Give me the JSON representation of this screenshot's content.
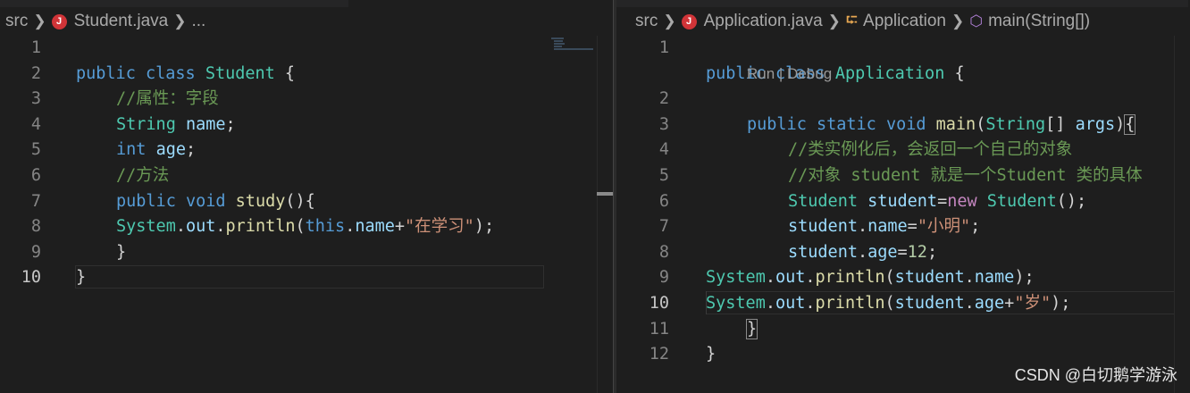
{
  "left": {
    "breadcrumb": {
      "folder": "src",
      "file": "Student.java",
      "more": "..."
    },
    "lines": [
      {
        "n": "1",
        "cur": false
      },
      {
        "n": "2",
        "cur": false
      },
      {
        "n": "3",
        "cur": false
      },
      {
        "n": "4",
        "cur": false
      },
      {
        "n": "5",
        "cur": false
      },
      {
        "n": "6",
        "cur": false
      },
      {
        "n": "7",
        "cur": false
      },
      {
        "n": "8",
        "cur": false
      },
      {
        "n": "9",
        "cur": false
      },
      {
        "n": "10",
        "cur": true
      }
    ],
    "code": {
      "l1": {
        "a": "public",
        "b": "class",
        "c": "Student",
        "d": " {"
      },
      "l2": {
        "a": "//属性：字段"
      },
      "l3": {
        "a": "String",
        "b": "name",
        "c": ";"
      },
      "l4": {
        "a": "int",
        "b": "age",
        "c": ";"
      },
      "l5": {
        "a": "//方法"
      },
      "l6": {
        "a": "public",
        "b": "void",
        "c": "study",
        "d": "(){"
      },
      "l7": {
        "a": "System",
        "b": ".",
        "c": "out",
        "d": ".",
        "e": "println",
        "f": "(",
        "g": "this",
        "h": ".",
        "i": "name",
        "j": "+",
        "k": "\"在学习\"",
        "l": ");"
      },
      "l8": {
        "a": "}"
      },
      "l9": {
        "a": "}"
      }
    }
  },
  "right": {
    "breadcrumb": {
      "folder": "src",
      "file": "Application.java",
      "class": "Application",
      "method": "main(String[])"
    },
    "codelens": "Run | Debug",
    "lines": [
      {
        "n": "1"
      },
      {
        "n": "2"
      },
      {
        "n": "3"
      },
      {
        "n": "4"
      },
      {
        "n": "5"
      },
      {
        "n": "6"
      },
      {
        "n": "7"
      },
      {
        "n": "8"
      },
      {
        "n": "9"
      },
      {
        "n": "10"
      },
      {
        "n": "11"
      },
      {
        "n": "12"
      }
    ],
    "code": {
      "l1": {
        "a": "public",
        "b": "class",
        "c": "Application",
        "d": " {"
      },
      "l2": {
        "a": "public",
        "b": "static",
        "c": "void",
        "d": "main",
        "e": "(",
        "f": "String",
        "g": "[] ",
        "h": "args",
        "i": ")",
        "j": "{"
      },
      "l3": {
        "a": "//类实例化后，会返回一个自己的对象"
      },
      "l4": {
        "a": "//对象 student 就是一个Student 类的具体"
      },
      "l5": {
        "a": "Student",
        "b": "student",
        "c": "=",
        "d": "new",
        "e": "Student",
        "f": "();"
      },
      "l6": {
        "a": "student",
        "b": ".",
        "c": "name",
        "d": "=",
        "e": "\"小明\"",
        "f": ";"
      },
      "l7": {
        "a": "student",
        "b": ".",
        "c": "age",
        "d": "=",
        "e": "12",
        "f": ";"
      },
      "l8": {
        "a": "System",
        "b": ".",
        "c": "out",
        "d": ".",
        "e": "println",
        "f": "(",
        "g": "student",
        "h": ".",
        "i": "name",
        "j": ");"
      },
      "l9": {
        "a": "System",
        "b": ".",
        "c": "out",
        "d": ".",
        "e": "println",
        "f": "(",
        "g": "student",
        "h": ".",
        "i": "age",
        "j": "+",
        "k": "\"岁\"",
        "l": ");"
      },
      "l10": {
        "a": "}"
      },
      "l11": {
        "a": "}"
      }
    }
  },
  "watermark": "CSDN @白切鹅学游泳"
}
